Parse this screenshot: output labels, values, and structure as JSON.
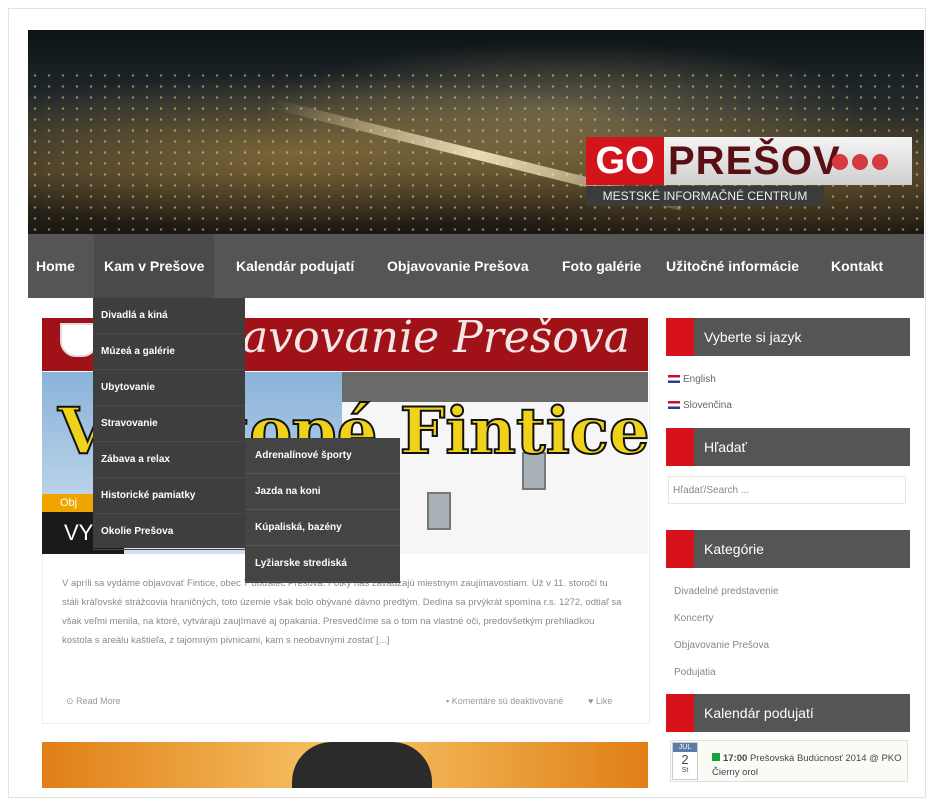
{
  "brand": {
    "go": "GO",
    "city": "PREŠOV",
    "subtitle": "MESTSKÉ INFORMAČNÉ CENTRUM"
  },
  "nav": {
    "items": [
      "Home",
      "Kam v Prešove",
      "Kalendár podujatí",
      "Objavovanie Prešova",
      "Foto galérie",
      "Užitočné informácie",
      "Kontakt"
    ]
  },
  "dropdown": {
    "items": [
      "Divadlá a kiná",
      "Múzeá a galérie",
      "Ubytovanie",
      "Stravovanie",
      "Zábava a relax",
      "Historické pamiatky",
      "Okolie Prešova"
    ]
  },
  "subdropdown": {
    "items": [
      "Adrenalínové športy",
      "Jazda na koni",
      "Kúpaliská, bazény",
      "Lyžiarske strediská"
    ]
  },
  "post": {
    "banner_text": "avovanie Prešova",
    "image_text": "Vyšatopé Fintice",
    "tag": "Obj",
    "title": "VY",
    "excerpt": "V apríli sa vydáme objavovať Fintice, obec 7 obďaleč Prešova. Fotky nás zavádzajú miestnym zaujímavostiam. Už v 11. storočí tu stáli kráľovské strážcovia hraničných, toto územie však bolo obývané dávno predtým. Dedina sa prvýkrát spomína r.s. 1272, odtiaľ sa však veľmi menila, na ktoré, vytvárajú zaujímavé aj opakania. Presvedčíme sa o tom na vlastné oči, predovšetkým prehliadkou kostola s areálu kaštieľa, z tajomným pivnicami, kam s neobavnými zostať [...]",
    "read_more": "Read More",
    "comments": "Komentáre sú deaktivované",
    "likes": "Like"
  },
  "sidebar": {
    "lang_title": "Vyberte si jazyk",
    "languages": [
      "English",
      "Slovenčina"
    ],
    "search_title": "Hľadať",
    "search_placeholder": "Hľadať/Search ...",
    "categories_title": "Kategórie",
    "categories": [
      "Divadelné predstavenie",
      "Koncerty",
      "Objavovanie Prešova",
      "Podujatia"
    ],
    "calendar_title": "Kalendár podujatí",
    "calendar_event": {
      "month": "JÚL",
      "day": "2",
      "weekday": "St",
      "time": "17:00",
      "text": "Prešovská Budúcnosť 2014 @ PKO Čierny orol"
    }
  },
  "colors": {
    "accent_red": "#d8121b",
    "nav_bg": "#555555",
    "dropdown_bg": "#3e3e3e"
  }
}
